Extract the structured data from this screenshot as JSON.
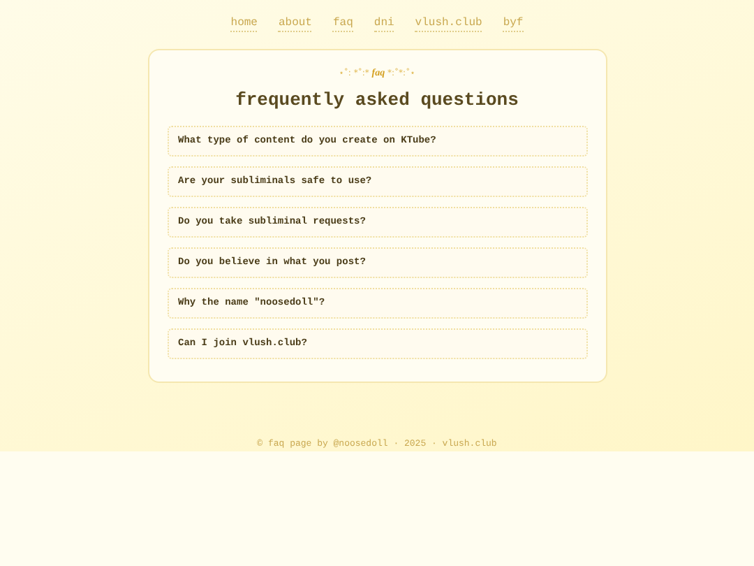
{
  "nav": [
    {
      "label": "home"
    },
    {
      "label": "about"
    },
    {
      "label": "faq"
    },
    {
      "label": "dni"
    },
    {
      "label": "vlush.club"
    },
    {
      "label": "byf"
    }
  ],
  "card": {
    "ornament_left": "⋆˚: *˚:* ",
    "ornament_label": "faq",
    "ornament_right": " *:˚*:˚⋆",
    "title": "frequently asked questions",
    "questions": [
      {
        "text": "What type of content do you create on KTube?",
        "expanded": false
      },
      {
        "text": "Are your subliminals safe to use?",
        "expanded": false
      },
      {
        "text": "Do you take subliminal requests?",
        "expanded": false
      },
      {
        "text": "Do you believe in what you post?",
        "expanded": false
      },
      {
        "text": "Why the name \"noosedoll\"?",
        "expanded": false
      },
      {
        "text": "Can I join vlush.club?",
        "expanded": false
      }
    ]
  },
  "footer": "© faq page by @noosedoll · 2025 · vlush.club"
}
